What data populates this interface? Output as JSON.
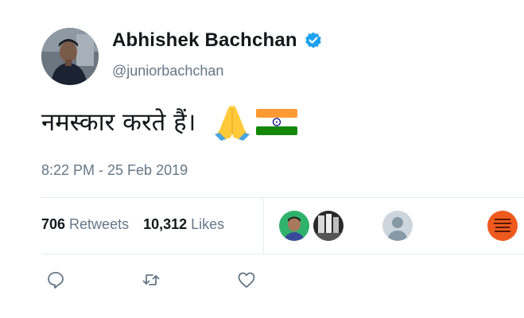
{
  "tweet": {
    "author": {
      "display_name": "Abhishek Bachchan",
      "handle": "@juniorbachchan",
      "verified": true,
      "avatar_icon": "user-avatar"
    },
    "text": "नमस्कार करते हैं।",
    "emojis": [
      "folded-hands-icon",
      "india-flag-icon"
    ],
    "timestamp": "8:22 PM - 25 Feb 2019",
    "stats": {
      "retweets_count": "706",
      "retweets_label": "Retweets",
      "likes_count": "10,312",
      "likes_label": "Likes"
    },
    "liked_by_avatars": [
      "liker-avatar-1",
      "liker-avatar-2",
      "liker-avatar-3",
      "liker-avatar-4"
    ],
    "actions": [
      "reply-icon",
      "retweet-icon",
      "like-icon"
    ],
    "colors": {
      "verified_blue": "#1da1f2",
      "secondary_text": "#657786",
      "primary_text": "#14171a",
      "divider": "#e6ecf0"
    }
  }
}
